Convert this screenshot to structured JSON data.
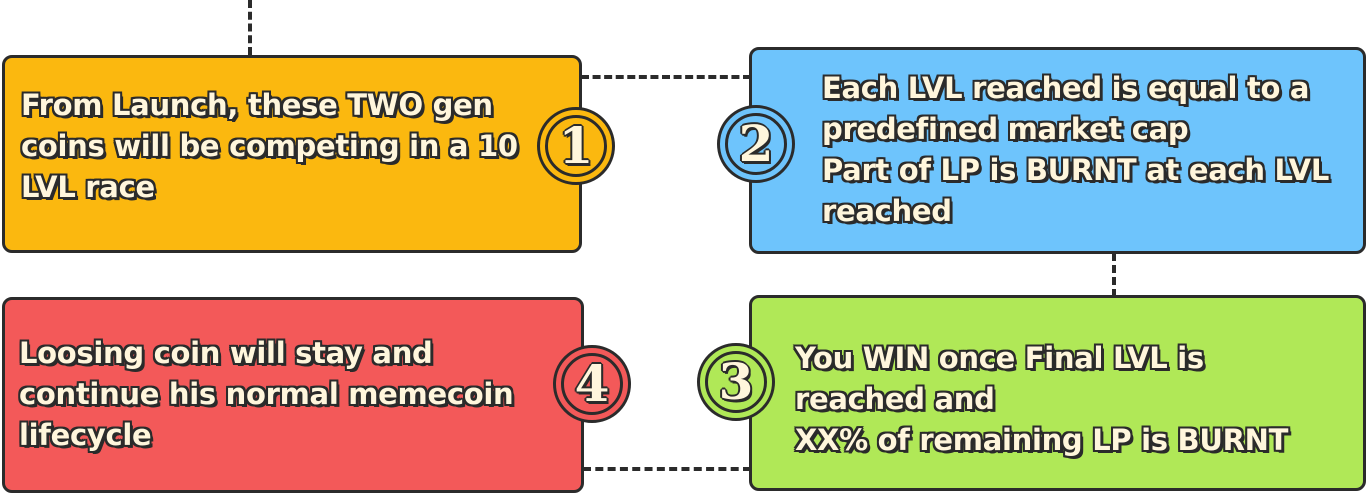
{
  "colors": {
    "outline": "#2b2b2b",
    "text_fill": "#fff6dc",
    "step1": "#fbb80f",
    "step2": "#6ec4fc",
    "step3": "#b0e857",
    "step4": "#f35959"
  },
  "steps": [
    {
      "number": "1",
      "text": "From Launch, these TWO gen\ncoins will be competing in a 10\nLVL  race"
    },
    {
      "number": "2",
      "text": "Each  LVL  reached is equal to a\npredefined market cap\nPart of LP is BURNT at each  LVL\nreached"
    },
    {
      "number": "3",
      "text": "You WIN once Final  LVL  is\nreached and\nXX% of remaining LP is BURNT"
    },
    {
      "number": "4",
      "text": "Loosing coin will stay and\ncontinue his normal memecoin\nlifecycle"
    }
  ]
}
